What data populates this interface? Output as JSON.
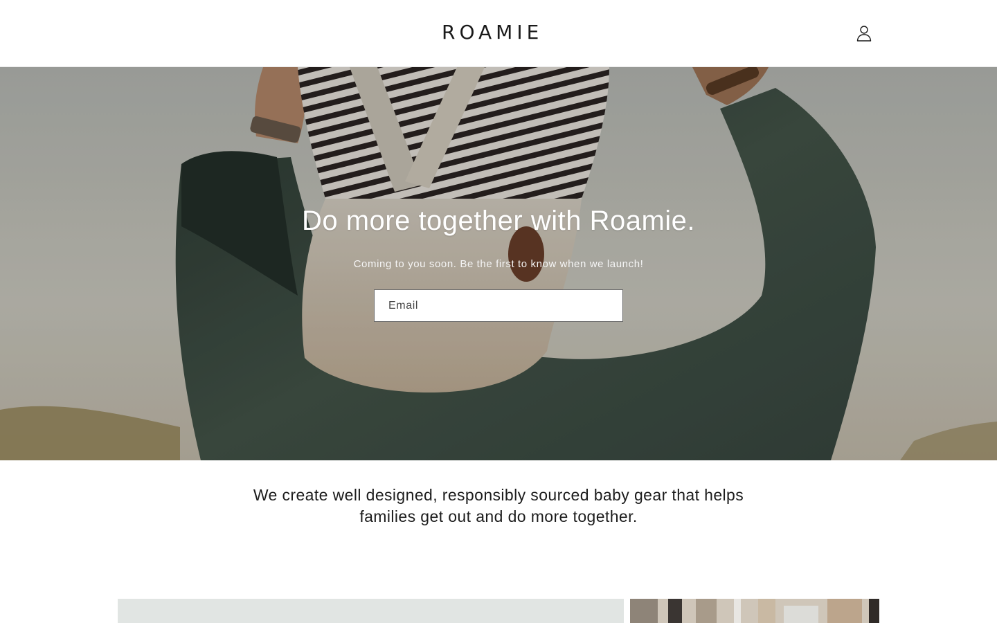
{
  "header": {
    "logo_text": "ROAMIE",
    "account_icon": "user-account-icon"
  },
  "hero": {
    "title": "Do more together with Roamie.",
    "subtitle": "Coming to you soon. Be the first to know when we launch!",
    "email_placeholder": "Email",
    "email_value": ""
  },
  "mission": {
    "line1": "We create well designed, responsibly sourced baby gear that helps",
    "line2": "families get out and do more together."
  },
  "colors": {
    "background": "#ffffff",
    "text": "#121212",
    "hero_text": "#ffffff",
    "jacket_green": "#3c4a40"
  }
}
